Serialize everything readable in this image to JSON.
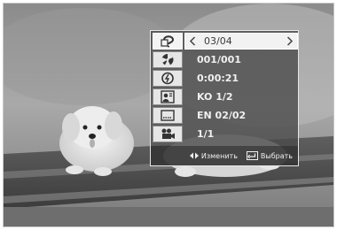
{
  "menu": {
    "rows": [
      {
        "icon": "title-icon",
        "value": "03/04",
        "selected": true
      },
      {
        "icon": "chapter-icon",
        "value": "001/001"
      },
      {
        "icon": "time-icon",
        "value": "0:00:21"
      },
      {
        "icon": "audio-icon",
        "value": "KO 1/2"
      },
      {
        "icon": "subtitle-icon",
        "value": "EN 02/02"
      },
      {
        "icon": "angle-icon",
        "value": "1/1"
      }
    ]
  },
  "footer": {
    "change_label": "Изменить",
    "select_label": "Выбрать"
  }
}
